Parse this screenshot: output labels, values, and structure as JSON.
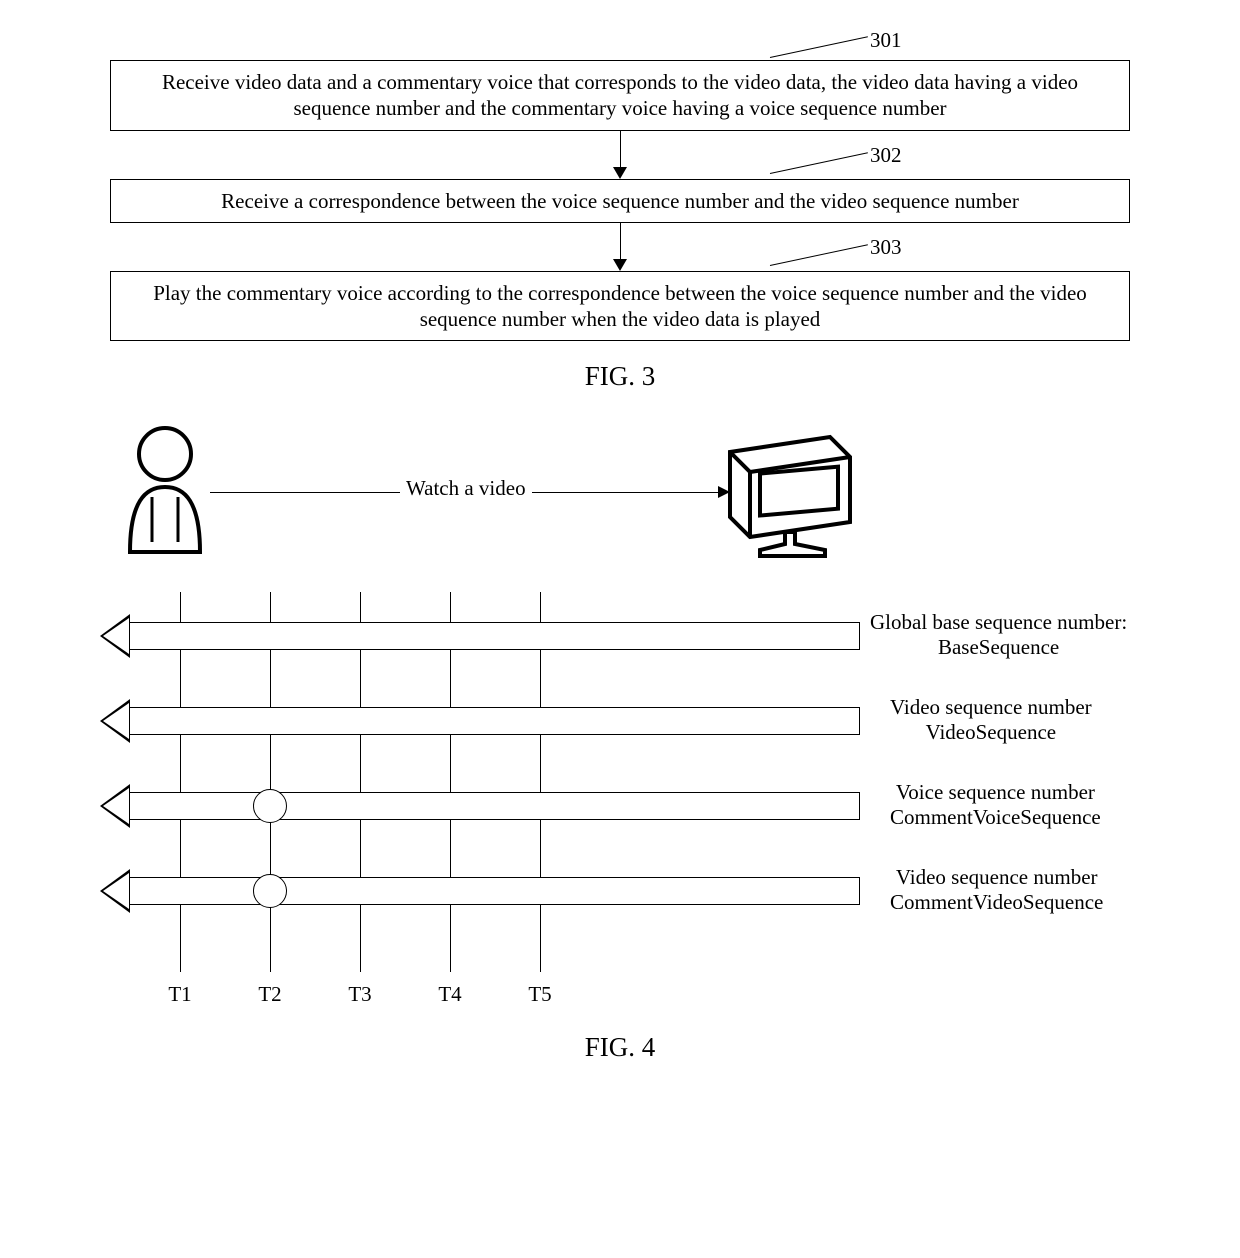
{
  "fig3": {
    "refs": [
      "301",
      "302",
      "303"
    ],
    "boxes": [
      "Receive video data and a commentary voice that corresponds to the video data, the video data having a video sequence number and the commentary voice having a voice sequence number",
      "Receive a correspondence between the voice sequence number and the video sequence number",
      "Play the commentary voice according to the correspondence between the voice sequence number and the video sequence number when the video data is played"
    ],
    "caption": "FIG. 3"
  },
  "fig4": {
    "watch_label": "Watch a video",
    "time_labels": [
      "T1",
      "T2",
      "T3",
      "T4",
      "T5"
    ],
    "arrow_labels": [
      "Global base sequence number:\nBaseSequence",
      "Video sequence number\nVideoSequence",
      "Voice sequence number\nCommentVoiceSequence",
      "Video sequence number\nCommentVideoSequence"
    ],
    "caption": "FIG. 4"
  },
  "chart_data": {
    "type": "diagram",
    "fig3_flow": [
      {
        "id": 301,
        "text": "Receive video data and a commentary voice that corresponds to the video data, the video data having a video sequence number and the commentary voice having a voice sequence number"
      },
      {
        "id": 302,
        "text": "Receive a correspondence between the voice sequence number and the video sequence number"
      },
      {
        "id": 303,
        "text": "Play the commentary voice according to the correspondence between the voice sequence number and the video sequence number when the video data is played"
      }
    ],
    "fig4_timeline": {
      "actors": [
        "user",
        "video-display"
      ],
      "action": "Watch a video",
      "time_ticks": [
        "T1",
        "T2",
        "T3",
        "T4",
        "T5"
      ],
      "sequences": [
        {
          "name": "BaseSequence",
          "label": "Global base sequence number",
          "marker_at": null
        },
        {
          "name": "VideoSequence",
          "label": "Video sequence number",
          "marker_at": null
        },
        {
          "name": "CommentVoiceSequence",
          "label": "Voice sequence number",
          "marker_at": "T2"
        },
        {
          "name": "CommentVideoSequence",
          "label": "Video sequence number",
          "marker_at": "T2"
        }
      ]
    }
  }
}
